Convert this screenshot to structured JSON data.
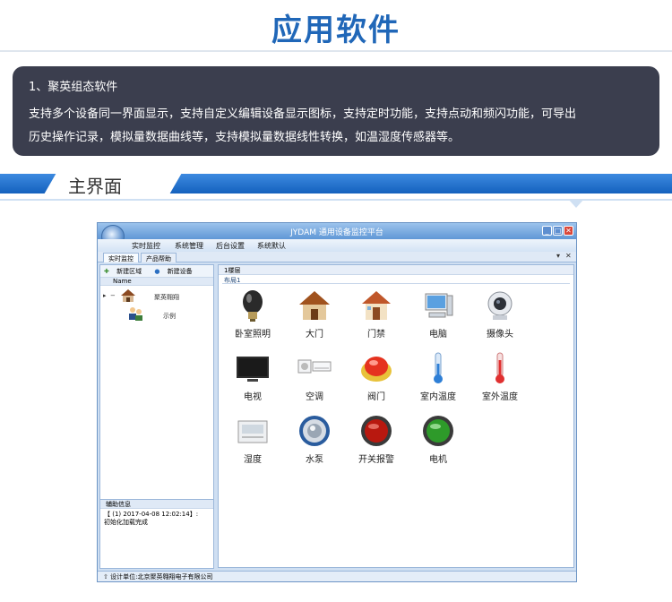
{
  "heading": {
    "title": "应用软件"
  },
  "info": {
    "subtitle": "1、聚英组态软件",
    "line1": "支持多个设备同一界面显示，支持自定义编辑设备显示图标，支持定时功能，支持点动和频闪功能，可导出",
    "line2": "历史操作记录，模拟量数据曲线等，支持模拟量数据线性转换，如温湿度传感器等。"
  },
  "section": {
    "label": "主界面"
  },
  "app": {
    "title": "JYDAM 通用设备监控平台",
    "menu": [
      "实时监控",
      "系统管理",
      "后台设置",
      "系统默认"
    ],
    "tabs": [
      "实时监控",
      "产品帮助"
    ],
    "tab_controls": {
      "dropdown": "▾",
      "close": "✕"
    },
    "window_buttons": {
      "min": "_",
      "max": "□",
      "close": "✕"
    },
    "left_toolbar": {
      "new_area": "新建区域",
      "new_device": "新建设备"
    },
    "tree": {
      "header": "Name",
      "root": "聚英翱翔",
      "child": "示例",
      "expander": "−",
      "selector": "▸"
    },
    "aux": {
      "header": "辅助信息",
      "log_line1": "【 (1) 2017-04-08 12:02:14】:",
      "log_line2": "初始化加载完成"
    },
    "layer": "1楼层",
    "layout": "布局1",
    "devices": [
      {
        "label": "卧室照明",
        "icon": "bulb-icon"
      },
      {
        "label": "大门",
        "icon": "house-icon"
      },
      {
        "label": "门禁",
        "icon": "door-house-icon"
      },
      {
        "label": "电脑",
        "icon": "computer-icon"
      },
      {
        "label": "摄像头",
        "icon": "camera-icon"
      },
      {
        "label": "电视",
        "icon": "tv-icon"
      },
      {
        "label": "空调",
        "icon": "air-conditioner-icon"
      },
      {
        "label": "阀门",
        "icon": "valve-button-icon"
      },
      {
        "label": "室内温度",
        "icon": "thermometer-blue-icon"
      },
      {
        "label": "室外温度",
        "icon": "thermometer-red-icon"
      },
      {
        "label": "湿度",
        "icon": "hygrometer-icon"
      },
      {
        "label": "水泵",
        "icon": "pump-icon"
      },
      {
        "label": "开关报警",
        "icon": "alarm-button-icon"
      },
      {
        "label": "电机",
        "icon": "motor-button-icon"
      }
    ],
    "status": "设计单位:北京聚英翱翔电子有限公司"
  },
  "colors": {
    "accent": "#2067b8",
    "panel": "#3b3e4e",
    "bar": "#1461be"
  }
}
